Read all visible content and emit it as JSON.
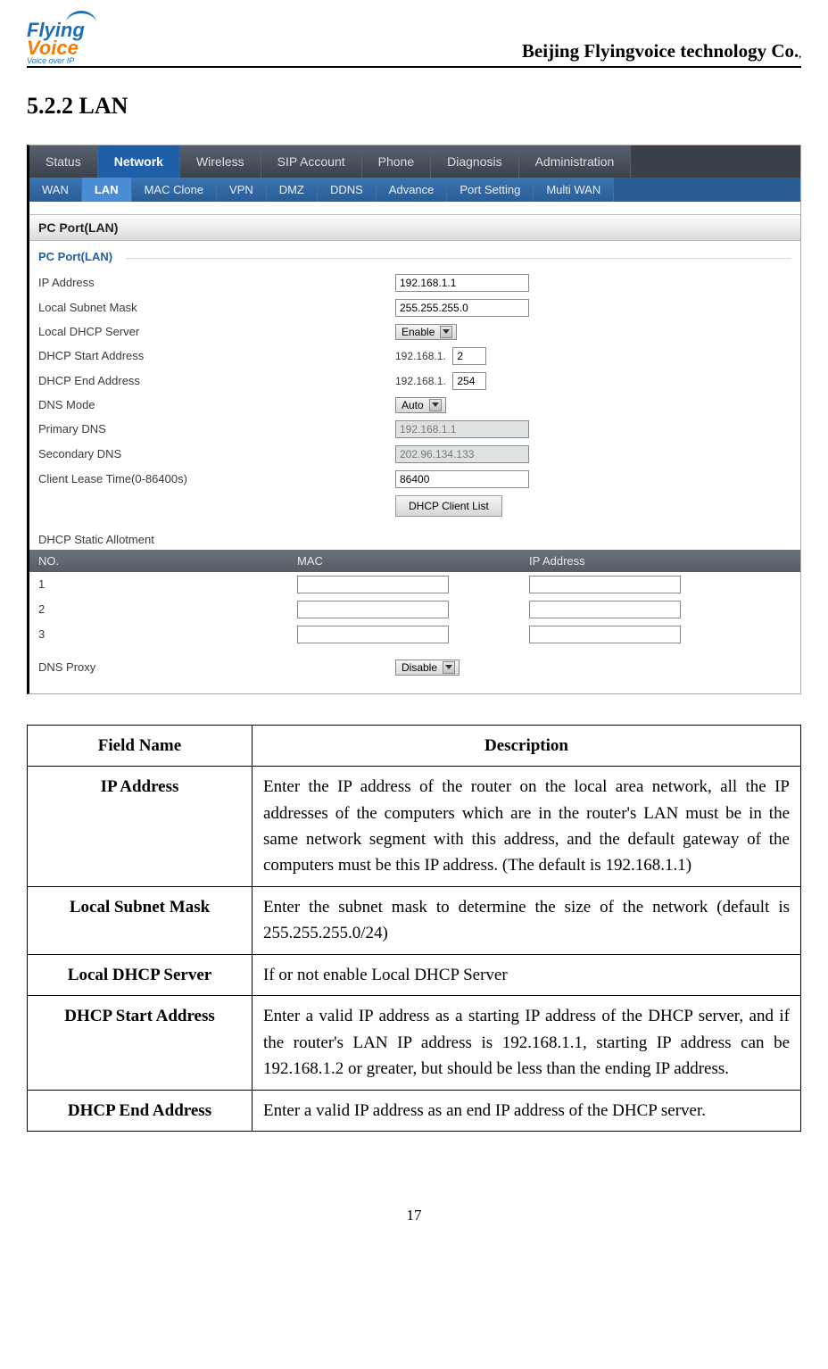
{
  "header": {
    "logo_top": "Flying",
    "logo_bottom": "Voice",
    "logo_tag": "Voice over IP",
    "company": "Beijing Flyingvoice technology Co.",
    "company_suffix": ","
  },
  "section_title": "5.2.2 LAN",
  "tabs_main": {
    "items": [
      "Status",
      "Network",
      "Wireless",
      "SIP Account",
      "Phone",
      "Diagnosis",
      "Administration"
    ],
    "active_index": 1
  },
  "tabs_sub": {
    "items": [
      "WAN",
      "LAN",
      "MAC Clone",
      "VPN",
      "DMZ",
      "DDNS",
      "Advance",
      "Port Setting",
      "Multi WAN"
    ],
    "active_index": 1
  },
  "panel": {
    "title": "PC Port(LAN)",
    "group_title": "PC Port(LAN)",
    "fields": {
      "ip_address": {
        "label": "IP Address",
        "value": "192.168.1.1"
      },
      "subnet_mask": {
        "label": "Local Subnet Mask",
        "value": "255.255.255.0"
      },
      "dhcp_server": {
        "label": "Local DHCP Server",
        "value": "Enable"
      },
      "dhcp_start": {
        "label": "DHCP Start Address",
        "prefix": "192.168.1.",
        "value": "2"
      },
      "dhcp_end": {
        "label": "DHCP End Address",
        "prefix": "192.168.1.",
        "value": "254"
      },
      "dns_mode": {
        "label": "DNS Mode",
        "value": "Auto"
      },
      "primary_dns": {
        "label": "Primary DNS",
        "value": "192.168.1.1"
      },
      "secondary_dns": {
        "label": "Secondary DNS",
        "value": "202.96.134.133"
      },
      "lease_time": {
        "label": "Client Lease Time(0-86400s)",
        "value": "86400"
      },
      "client_list_btn": "DHCP Client List"
    },
    "static": {
      "title": "DHCP Static Allotment",
      "headers": [
        "NO.",
        "MAC",
        "IP Address"
      ],
      "rows": [
        {
          "no": "1",
          "mac": "",
          "ip": ""
        },
        {
          "no": "2",
          "mac": "",
          "ip": ""
        },
        {
          "no": "3",
          "mac": "",
          "ip": ""
        }
      ]
    },
    "dns_proxy": {
      "label": "DNS Proxy",
      "value": "Disable"
    }
  },
  "desc_table": {
    "head_field": "Field Name",
    "head_desc": "Description",
    "rows": [
      {
        "field": "IP Address",
        "desc": "Enter the IP address of the router on the local area network, all the IP addresses of the computers which are in the router's LAN must be in the same network segment with this address, and the default gateway of the computers must be this IP address. (The default is 192.168.1.1)"
      },
      {
        "field": "Local Subnet Mask",
        "desc": "Enter the subnet mask to determine the size of the network (default is 255.255.255.0/24)"
      },
      {
        "field": "Local DHCP Server",
        "desc": "If or not enable Local DHCP Server"
      },
      {
        "field": "DHCP Start Address",
        "desc": "Enter a valid IP address as a starting IP address of the DHCP server, and if the router's LAN IP address is 192.168.1.1, starting IP address can be 192.168.1.2 or greater, but should be less than the ending IP address."
      },
      {
        "field": "DHCP End Address",
        "desc": "Enter a valid IP address as an end IP address of the DHCP server."
      }
    ]
  },
  "page_number": "17"
}
